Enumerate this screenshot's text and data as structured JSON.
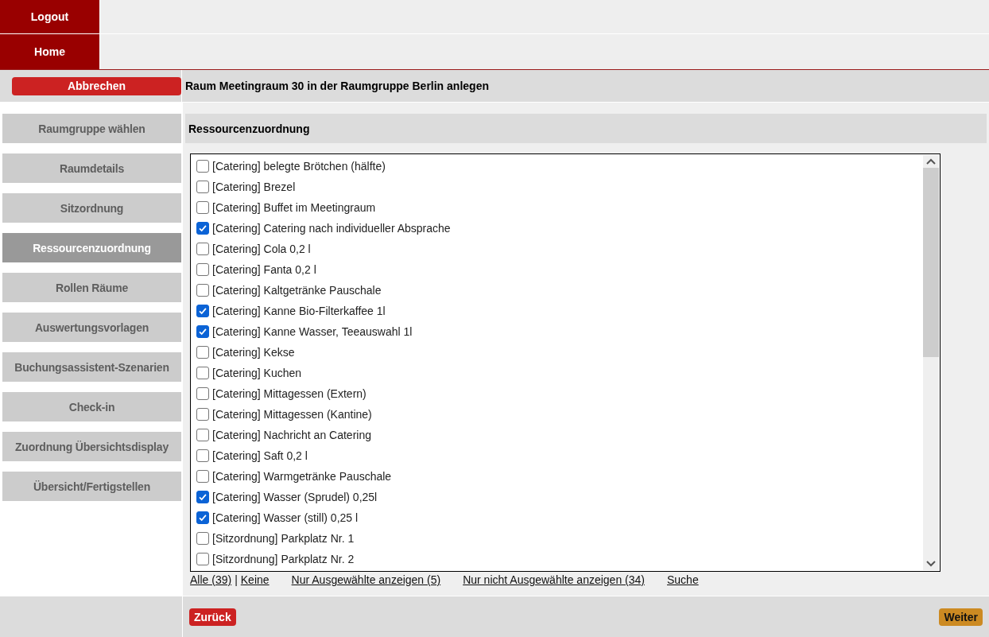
{
  "top_nav": [
    {
      "label": "Logout"
    },
    {
      "label": "Home"
    }
  ],
  "cancel_button": "Abbrechen",
  "page_title": "Raum Meetingraum 30 in der Raumgruppe Berlin anlegen",
  "steps": [
    {
      "label": "Raumgruppe wählen",
      "selected": false
    },
    {
      "label": "Raumdetails",
      "selected": false
    },
    {
      "label": "Sitzordnung",
      "selected": false
    },
    {
      "label": "Ressourcenzuordnung",
      "selected": true
    },
    {
      "label": "Rollen Räume",
      "selected": false
    },
    {
      "label": "Auswertungsvorlagen",
      "selected": false
    },
    {
      "label": "Buchungsassistent-Szenarien",
      "selected": false
    },
    {
      "label": "Check-in",
      "selected": false
    },
    {
      "label": "Zuordnung Übersichtsdisplay",
      "selected": false
    },
    {
      "label": "Übersicht/Fertigstellen",
      "selected": false
    }
  ],
  "section_title": "Ressourcenzuordnung",
  "resources": [
    {
      "label": "[Catering] belegte Brötchen (hälfte)",
      "checked": false
    },
    {
      "label": "[Catering] Brezel",
      "checked": false
    },
    {
      "label": "[Catering] Buffet im Meetingraum",
      "checked": false
    },
    {
      "label": "[Catering] Catering nach individueller Absprache",
      "checked": true
    },
    {
      "label": "[Catering] Cola 0,2 l",
      "checked": false
    },
    {
      "label": "[Catering] Fanta 0,2 l",
      "checked": false
    },
    {
      "label": "[Catering] Kaltgetränke Pauschale",
      "checked": false
    },
    {
      "label": "[Catering] Kanne Bio-Filterkaffee 1l",
      "checked": true
    },
    {
      "label": "[Catering] Kanne Wasser, Teeauswahl 1l",
      "checked": true
    },
    {
      "label": "[Catering] Kekse",
      "checked": false
    },
    {
      "label": "[Catering] Kuchen",
      "checked": false
    },
    {
      "label": "[Catering] Mittagessen (Extern)",
      "checked": false
    },
    {
      "label": "[Catering] Mittagessen (Kantine)",
      "checked": false
    },
    {
      "label": "[Catering] Nachricht an Catering",
      "checked": false
    },
    {
      "label": "[Catering] Saft 0,2 l",
      "checked": false
    },
    {
      "label": "[Catering] Warmgetränke Pauschale",
      "checked": false
    },
    {
      "label": "[Catering] Wasser (Sprudel) 0,25l",
      "checked": true
    },
    {
      "label": "[Catering] Wasser (still) 0,25 l",
      "checked": true
    },
    {
      "label": "[Sitzordnung] Parkplatz Nr. 1",
      "checked": false
    },
    {
      "label": "[Sitzordnung] Parkplatz Nr. 2",
      "checked": false
    }
  ],
  "select_links": {
    "all": "Alle (39)",
    "separator": "|",
    "none": "Keine",
    "only_selected": "Nur Ausgewählte anzeigen (5)",
    "only_unselected": "Nur nicht Ausgewählte anzeigen (34)",
    "search": "Suche"
  },
  "back_button": "Zurück",
  "next_button": "Weiter"
}
